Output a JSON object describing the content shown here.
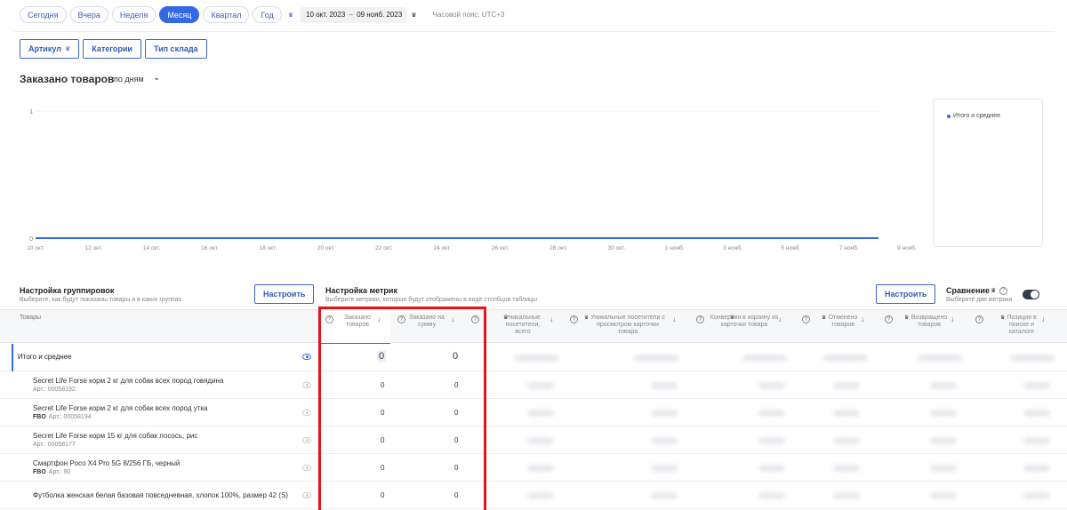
{
  "period": {
    "buttons": [
      {
        "label": "Сегодня",
        "active": false
      },
      {
        "label": "Вчера",
        "active": false
      },
      {
        "label": "Неделя",
        "active": false
      },
      {
        "label": "Месяц",
        "active": true
      },
      {
        "label": "Квартал",
        "active": false
      },
      {
        "label": "Год",
        "active": false
      }
    ],
    "date_from": "10 окт. 2023",
    "date_to": "09 нояб. 2023",
    "timezone": "Часовой пояс: UTC+3"
  },
  "filters": [
    "Артикул",
    "Категории",
    "Тип склада"
  ],
  "chart_header": {
    "title": "Заказано товаров",
    "granularity": "по дням"
  },
  "chart_data": {
    "type": "line",
    "x": [
      "10 окт.",
      "12 окт.",
      "14 окт.",
      "16 окт.",
      "18 окт.",
      "20 окт.",
      "22 окт.",
      "24 окт.",
      "26 окт.",
      "28 окт.",
      "30 окт.",
      "1 нояб.",
      "3 нояб.",
      "5 нояб.",
      "7 нояб.",
      "9 нояб."
    ],
    "y_ticks": [
      "1",
      "0"
    ],
    "ylim": [
      0,
      1
    ],
    "series": [
      {
        "name": "Итого и среднее",
        "values": [
          0,
          0,
          0,
          0,
          0,
          0,
          0,
          0,
          0,
          0,
          0,
          0,
          0,
          0,
          0,
          0
        ]
      }
    ],
    "legend_position": "right",
    "grid": false
  },
  "colors": {
    "accent": "#3469e6",
    "highlight_frame": "#e4141b"
  },
  "grouping": {
    "title": "Настройка группировок",
    "subtitle": "Выберите, как будут показаны товары и в каких группах",
    "button": "Настроить"
  },
  "metrics_settings": {
    "title": "Настройка метрик",
    "subtitle": "Выберите метрики, которые будут отображены в виде столбцов таблицы",
    "button": "Настроить"
  },
  "comparison": {
    "title": "Сравнение",
    "subtitle": "Выберите две метрики",
    "enabled": false
  },
  "table": {
    "products_header": "Товары",
    "columns": [
      "Заказано товаров",
      "Заказано на сумму",
      "Уникальные посетители, всего",
      "Уникальные посетители с просмотром карточки товара",
      "Конверсия в корзину из карточки товара",
      "Отменено товаров",
      "Возвращено товаров",
      "Позиция в поиске и каталоге"
    ],
    "total_label": "Итого и среднее",
    "total_values": [
      "0",
      "0"
    ],
    "rows": [
      {
        "name": "Secret Life Forse корм 2 кг для собак всех пород говядина",
        "badge": "",
        "art": "Арт.: 00058192",
        "values": [
          "0",
          "0"
        ]
      },
      {
        "name": "Secret Life Forse корм 2 кг для собак всех пород утка",
        "badge": "FBO",
        "art": "Арт.: 00058194",
        "values": [
          "0",
          "0"
        ]
      },
      {
        "name": "Secret Life Forse корм 15 кг для собак лосось, рис",
        "badge": "",
        "art": "Арт.: 00058177",
        "values": [
          "0",
          "0"
        ]
      },
      {
        "name": "Смартфон Poco X4 Pro 5G 8/256 ГБ, черный",
        "badge": "FBO",
        "art": "Арт.: 90",
        "values": [
          "0",
          "0"
        ]
      },
      {
        "name": "Футболка женская белая базовая повседневная, хлопок 100%, размер 42 (S)",
        "badge": "",
        "art": "",
        "values": [
          "0",
          "0"
        ]
      }
    ]
  }
}
